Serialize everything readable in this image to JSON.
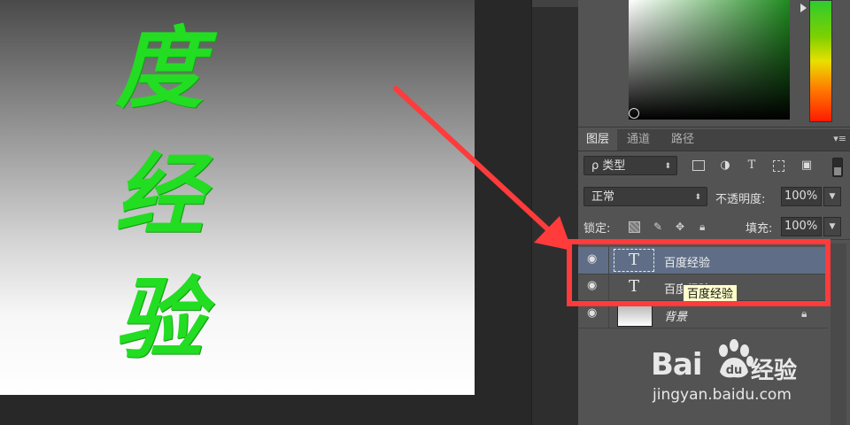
{
  "canvas": {
    "chars": [
      "度",
      "经",
      "验"
    ],
    "text_color": "#22dd22"
  },
  "layers_panel": {
    "tabs": [
      "图层",
      "通道",
      "路径"
    ],
    "panel_menu_icon": "panel-menu-icon",
    "filter": {
      "value": "ρ 类型"
    },
    "blend_mode": "正常",
    "opacity_label": "不透明度:",
    "opacity_value": "100%",
    "lock_label": "锁定:",
    "fill_label": "填充:",
    "fill_value": "100%",
    "layers": [
      {
        "type_icon": "T",
        "name": "百度经验",
        "selected": true
      },
      {
        "type_icon": "T",
        "name": "百度经验",
        "selected": false
      },
      {
        "name": "背景",
        "locked": true
      }
    ]
  },
  "tooltip": "百度经验",
  "annotation": {
    "color": "#ff3b3b"
  },
  "watermark": {
    "brand_left": "Bai",
    "brand_paw": "du",
    "brand_right": "经验",
    "url": "jingyan.baidu.com"
  }
}
